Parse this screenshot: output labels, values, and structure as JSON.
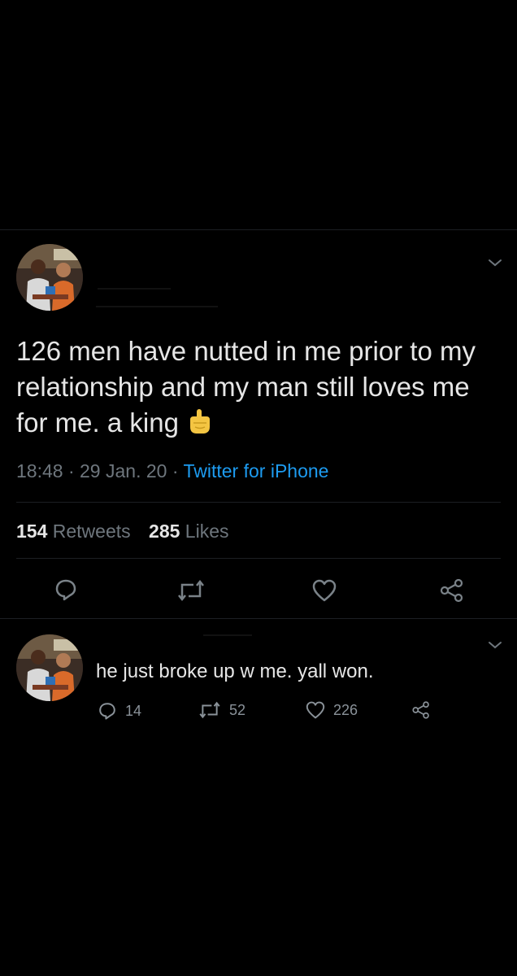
{
  "tweet": {
    "text": "126 men have nutted in me prior to my relationship and my man still loves me for me. a king",
    "emoji_icon": "middle-finger-emoji",
    "time": "18:48",
    "date": "29 Jan. 20",
    "separator": "·",
    "source": "Twitter for iPhone",
    "retweets_count": "154",
    "retweets_label": "Retweets",
    "likes_count": "285",
    "likes_label": "Likes",
    "actions": [
      "reply-icon",
      "retweet-icon",
      "like-icon",
      "share-icon"
    ]
  },
  "reply": {
    "text": "he just broke up w me. yall won.",
    "reply_count": "14",
    "retweet_count": "52",
    "like_count": "226"
  },
  "colors": {
    "background": "#000000",
    "link": "#1d9bf0",
    "muted": "#6e767d",
    "text": "#e6e6e6"
  }
}
